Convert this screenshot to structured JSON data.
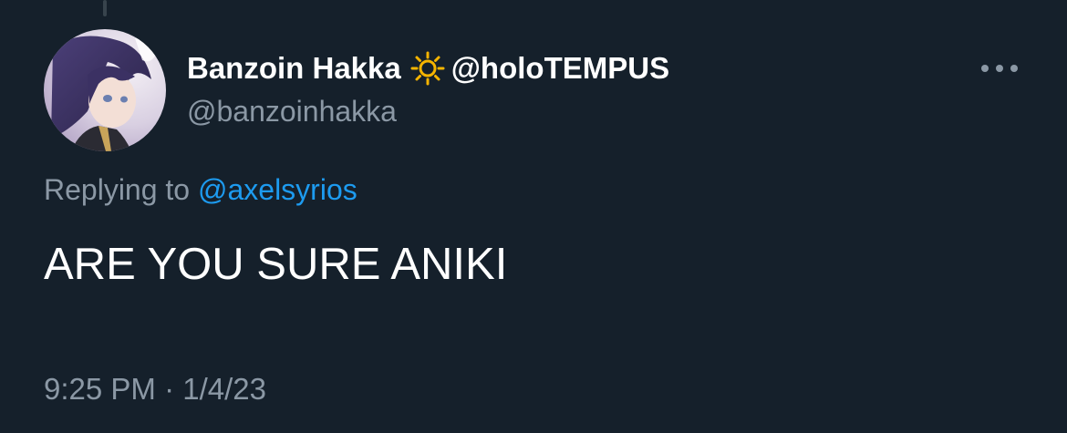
{
  "colors": {
    "background": "#15202b",
    "primary_text": "#ffffff",
    "secondary_text": "#8b98a5",
    "link": "#1d9bf0"
  },
  "author": {
    "display_name": "Banzoin Hakka",
    "name_emoji_icon": "sun-icon",
    "name_suffix": "@holoTEMPUS",
    "handle": "@banzoinhakka"
  },
  "reply": {
    "prefix": "Replying to ",
    "mention": "@axelsyrios"
  },
  "tweet": {
    "text": "ARE YOU SURE ANIKI"
  },
  "meta": {
    "timestamp": "9:25 PM · 1/4/23"
  }
}
